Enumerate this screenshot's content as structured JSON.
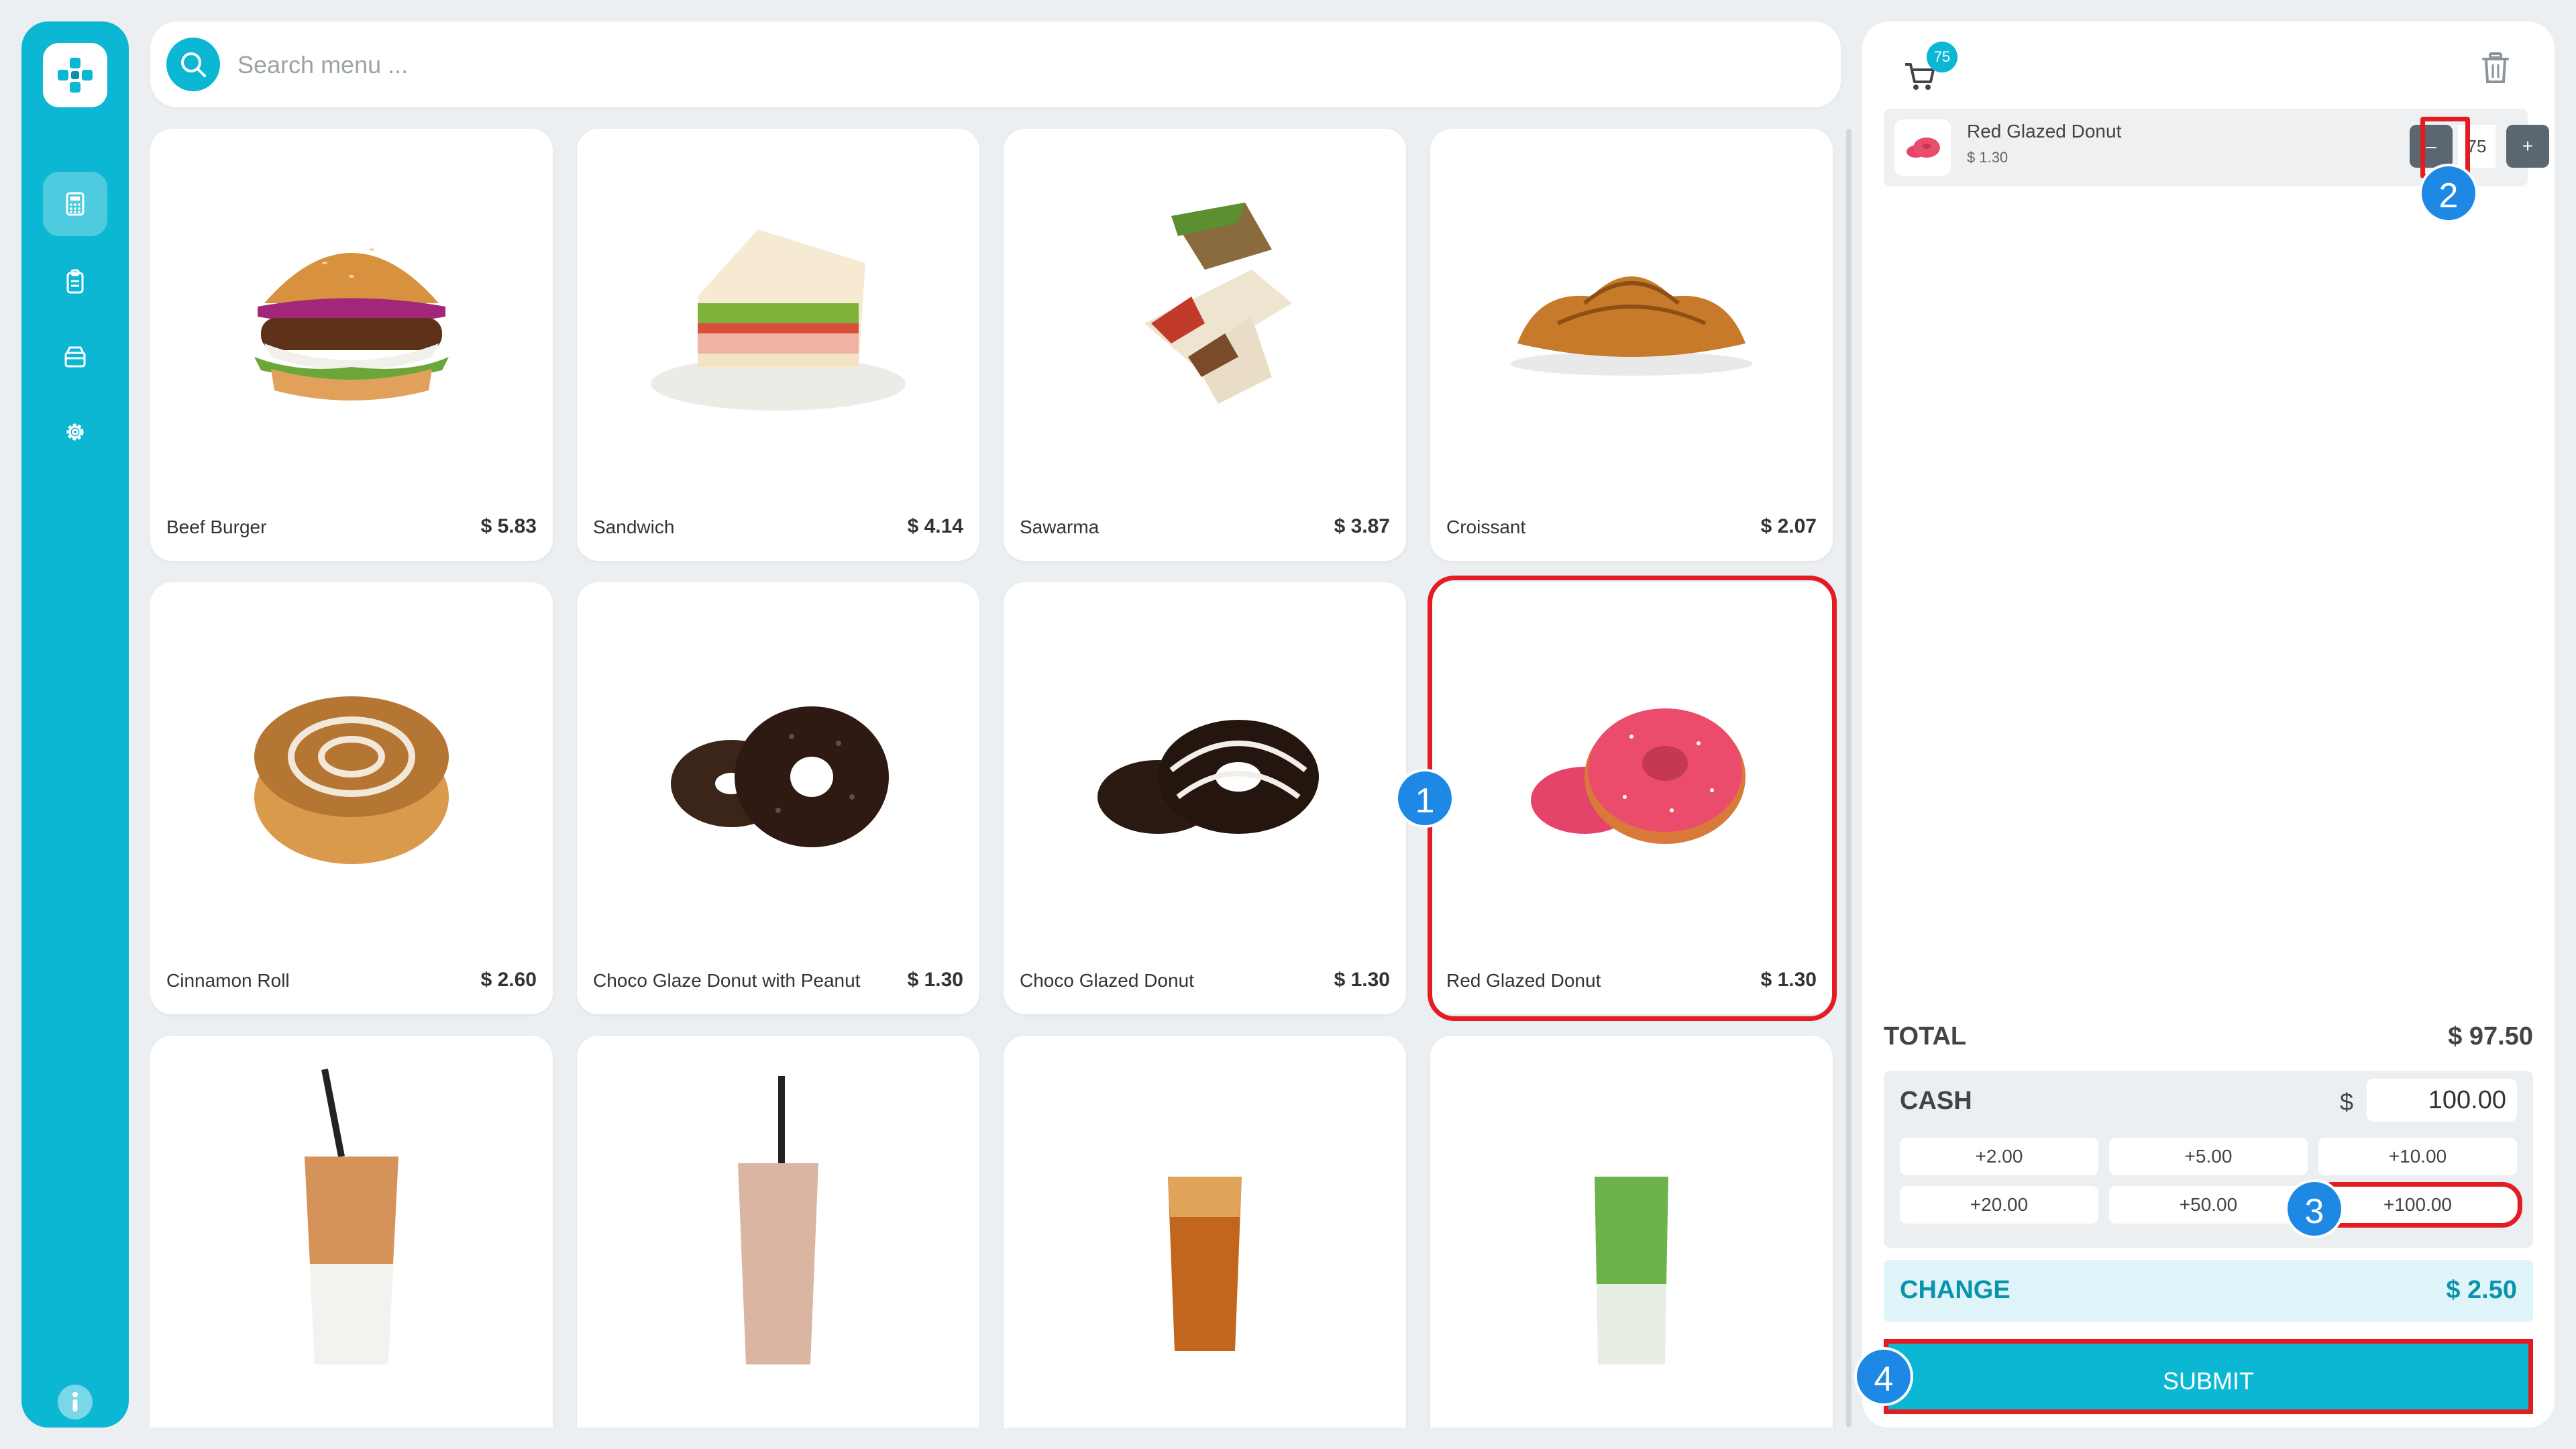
{
  "colors": {
    "accent": "#0bb7d3",
    "highlight": "#e31b23",
    "step_badge": "#1e88e5"
  },
  "search": {
    "placeholder": "Search menu ..."
  },
  "sidebar": {
    "items": [
      {
        "icon": "calculator-icon",
        "active": true
      },
      {
        "icon": "clipboard-icon",
        "active": false
      },
      {
        "icon": "box-icon",
        "active": false
      },
      {
        "icon": "gear-icon",
        "active": false
      }
    ],
    "bottom_icon": "info-icon"
  },
  "menu": {
    "items": [
      {
        "name": "Beef Burger",
        "price": "$ 5.83",
        "icon": "burger-image"
      },
      {
        "name": "Sandwich",
        "price": "$ 4.14",
        "icon": "sandwich-image"
      },
      {
        "name": "Sawarma",
        "price": "$ 3.87",
        "icon": "shawarma-image"
      },
      {
        "name": "Croissant",
        "price": "$ 2.07",
        "icon": "croissant-image"
      },
      {
        "name": "Cinnamon Roll",
        "price": "$ 2.60",
        "icon": "cinnamon-roll-image"
      },
      {
        "name": "Choco Glaze Donut with Peanut",
        "price": "$ 1.30",
        "icon": "donut-image"
      },
      {
        "name": "Choco Glazed Donut",
        "price": "$ 1.30",
        "icon": "donut-image"
      },
      {
        "name": "Red Glazed Donut",
        "price": "$ 1.30",
        "icon": "donut-image"
      },
      {
        "name": "",
        "price": "",
        "icon": "iced-coffee-image"
      },
      {
        "name": "",
        "price": "",
        "icon": "iced-chocolate-image"
      },
      {
        "name": "",
        "price": "",
        "icon": "iced-tea-image"
      },
      {
        "name": "",
        "price": "",
        "icon": "matcha-latte-image"
      }
    ]
  },
  "cart": {
    "badge": "75",
    "items": [
      {
        "name": "Red Glazed Donut",
        "price": "$ 1.30",
        "qty": "75",
        "minus": "–",
        "plus": "+"
      }
    ]
  },
  "summary": {
    "total_label": "TOTAL",
    "total_value": "$ 97.50",
    "cash_label": "CASH",
    "currency": "$",
    "cash_value": "100.00",
    "quick_amounts": [
      "+2.00",
      "+5.00",
      "+10.00",
      "+20.00",
      "+50.00",
      "+100.00"
    ],
    "change_label": "CHANGE",
    "change_value": "$ 2.50",
    "submit_label": "SUBMIT"
  },
  "steps": [
    "1",
    "2",
    "3",
    "4"
  ]
}
